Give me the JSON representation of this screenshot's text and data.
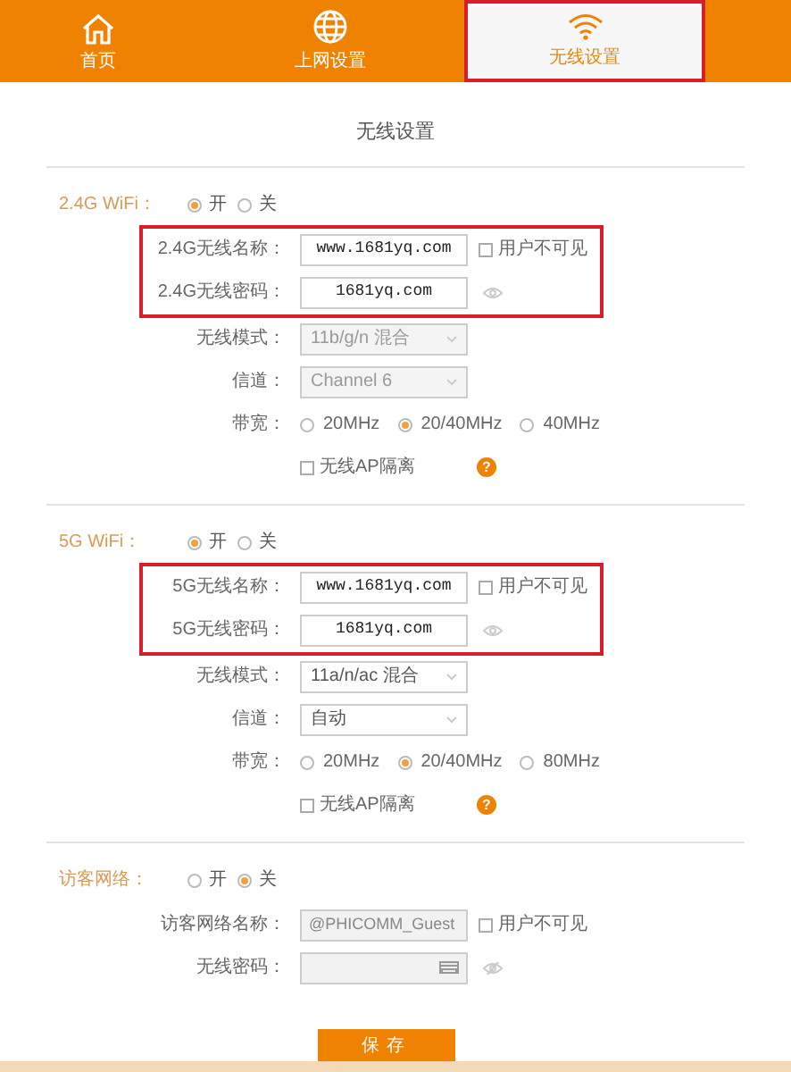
{
  "nav": {
    "tabs": [
      {
        "label": "首页",
        "selected": false,
        "highlighted": false
      },
      {
        "label": "上网设置",
        "selected": false,
        "highlighted": false
      },
      {
        "label": "无线设置",
        "selected": true,
        "highlighted": true
      }
    ]
  },
  "page_title": "无线设置",
  "sections": [
    {
      "label": "2.4G WiFi：",
      "power": [
        {
          "label": "开",
          "selected": true
        },
        {
          "label": "关",
          "selected": false
        }
      ],
      "highlighted": true,
      "primary_fields": [
        {
          "kind": "text",
          "label": "2.4G无线名称：",
          "value": "www.1681yq.com",
          "disabled": false,
          "hide_option": {
            "label": "用户不可见",
            "checked": false
          }
        },
        {
          "kind": "password",
          "label": "2.4G无线密码：",
          "value": "1681yq.com",
          "disabled": false
        }
      ],
      "more_fields": [
        {
          "kind": "select",
          "label": "无线模式：",
          "value": "11b/g/n 混合",
          "disabled": true
        },
        {
          "kind": "select",
          "label": "信道：",
          "value": "Channel 6",
          "disabled": true
        },
        {
          "kind": "radios",
          "label": "带宽：",
          "options": [
            {
              "label": "20MHz",
              "selected": false
            },
            {
              "label": "20/40MHz",
              "selected": true
            },
            {
              "label": "40MHz",
              "selected": false
            }
          ]
        },
        {
          "kind": "checkbox",
          "label": "无线AP隔离",
          "checked": false,
          "help": "?"
        }
      ]
    },
    {
      "label": "5G WiFi：",
      "power": [
        {
          "label": "开",
          "selected": true
        },
        {
          "label": "关",
          "selected": false
        }
      ],
      "highlighted": true,
      "primary_fields": [
        {
          "kind": "text",
          "label": "5G无线名称：",
          "value": "www.1681yq.com",
          "disabled": false,
          "hide_option": {
            "label": "用户不可见",
            "checked": false
          }
        },
        {
          "kind": "password",
          "label": "5G无线密码：",
          "value": "1681yq.com",
          "disabled": false
        }
      ],
      "more_fields": [
        {
          "kind": "select",
          "label": "无线模式：",
          "value": "11a/n/ac 混合",
          "disabled": false
        },
        {
          "kind": "select",
          "label": "信道：",
          "value": "自动",
          "disabled": false
        },
        {
          "kind": "radios",
          "label": "带宽：",
          "options": [
            {
              "label": "20MHz",
              "selected": false
            },
            {
              "label": "20/40MHz",
              "selected": true
            },
            {
              "label": "80MHz",
              "selected": false
            }
          ]
        },
        {
          "kind": "checkbox",
          "label": "无线AP隔离",
          "checked": false,
          "help": "?"
        }
      ]
    },
    {
      "label": "访客网络：",
      "power": [
        {
          "label": "开",
          "selected": false
        },
        {
          "label": "关",
          "selected": true
        }
      ],
      "highlighted": false,
      "primary_fields": [
        {
          "kind": "text",
          "label": "访客网络名称：",
          "value": "@PHICOMM_Guest",
          "disabled": true,
          "hide_option": {
            "label": "用户不可见",
            "checked": false
          }
        },
        {
          "kind": "password",
          "label": "无线密码：",
          "disabled": true
        }
      ]
    }
  ],
  "save_button": "保存"
}
